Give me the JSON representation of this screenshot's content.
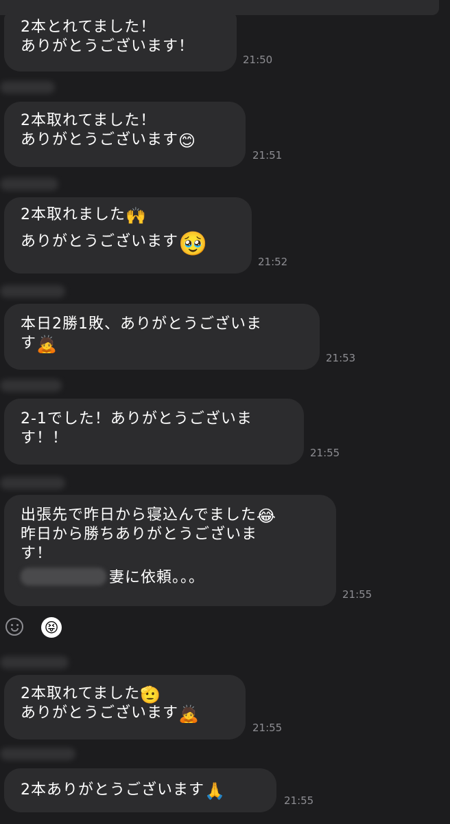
{
  "messages": [
    {
      "lines": [
        "2本とれてました！",
        "ありがとうございます！"
      ],
      "emojis": [],
      "time": "21:50"
    },
    {
      "lines": [
        "2本取れてました！",
        "ありがとうございます"
      ],
      "emojis": [
        "😊"
      ],
      "time": "21:51"
    },
    {
      "lines": [
        "2本取れました",
        "ありがとうございます"
      ],
      "emojis": [
        "🙌",
        "🥹"
      ],
      "time": "21:52"
    },
    {
      "lines": [
        "本日2勝1敗、ありがとうございま",
        "す"
      ],
      "emojis": [
        "🙇"
      ],
      "time": "21:53"
    },
    {
      "lines": [
        "2-1でした！ありがとうございま",
        "す！！"
      ],
      "emojis": [],
      "time": "21:55"
    },
    {
      "lines": [
        "出張先で昨日から寝込んでました",
        "昨日から勝ちありがとうございま",
        "す！",
        "妻に依頼。。。"
      ],
      "emojis": [
        "😂"
      ],
      "time": "21:55"
    },
    {
      "lines": [
        "2本取れてました",
        "ありがとうございます"
      ],
      "emojis": [
        "🫡",
        "🙇"
      ],
      "time": "21:55"
    },
    {
      "lines": [
        "2本ありがとうございます"
      ],
      "emojis": [
        "🙏"
      ],
      "time": "21:55"
    }
  ],
  "reaction": {
    "add_icon": "smile-add-icon",
    "sticker": "😝"
  }
}
